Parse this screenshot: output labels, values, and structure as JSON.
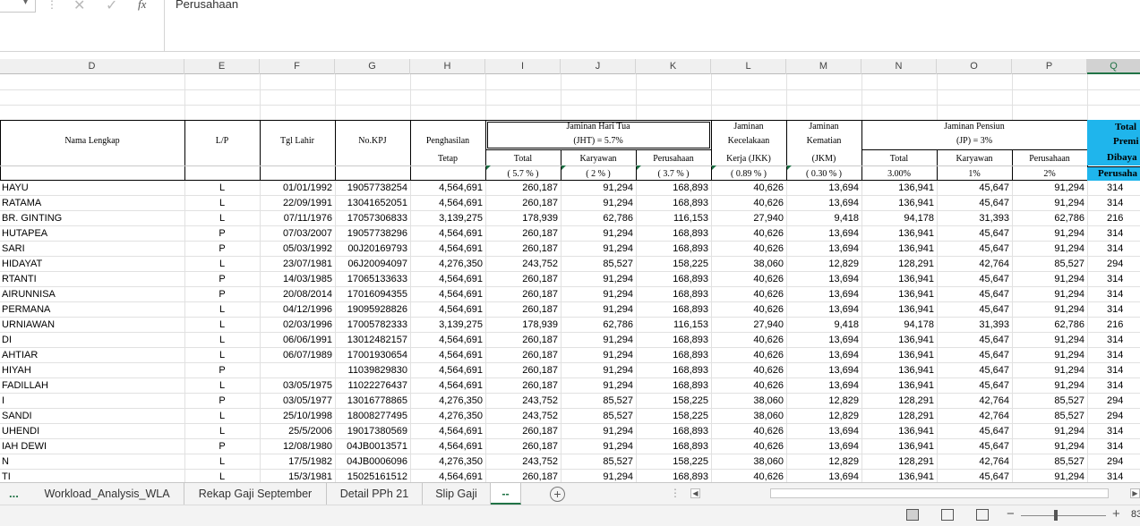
{
  "formula_bar": {
    "cancel_icon": "✕",
    "enter_icon": "✓",
    "fx_label": "fx",
    "content": "Perusahaan"
  },
  "columns": [
    "D",
    "E",
    "F",
    "G",
    "H",
    "I",
    "J",
    "K",
    "L",
    "M",
    "N",
    "O",
    "P",
    "Q"
  ],
  "header": {
    "nama": "Nama Lengkap",
    "lp": "L/P",
    "tgl_lahir": "Tgl Lahir",
    "no_kpj": "No.KPJ",
    "penghasilan_1": "Penghasilan",
    "penghasilan_2": "Tetap",
    "jht_1": "Jaminan Hari Tua",
    "jht_2": "(JHT) = 5.7%",
    "jht_total": "Total",
    "jht_total_pct": "( 5.7 % )",
    "jht_karyawan": "Karyawan",
    "jht_karyawan_pct": "( 2 % )",
    "jht_perusahaan": "Perusahaan",
    "jht_perusahaan_pct": "( 3.7 % )",
    "jkk_1": "Jaminan",
    "jkk_2": "Kecelakaan",
    "jkk_3": "Kerja (JKK)",
    "jkk_pct": "( 0.89 % )",
    "jkm_1": "Jaminan",
    "jkm_2": "Kematian",
    "jkm_3": "(JKM)",
    "jkm_pct": "( 0.30 % )",
    "jp_1": "Jaminan Pensiun",
    "jp_2": "(JP) = 3%",
    "jp_total": "Total",
    "jp_total_pct": "3.00%",
    "jp_karyawan": "Karyawan",
    "jp_karyawan_pct": "1%",
    "jp_perusahaan": "Perusahaan",
    "jp_perusahaan_pct": "2%",
    "q_1": "Total",
    "q_2": "Premi",
    "q_3": "Dibaya",
    "q_4": "Perusaha"
  },
  "rows": [
    [
      "HAYU",
      "L",
      "01/01/1992",
      "19057738254",
      "4,564,691",
      "260,187",
      "91,294",
      "168,893",
      "40,626",
      "13,694",
      "136,941",
      "45,647",
      "91,294",
      "314"
    ],
    [
      "RATAMA",
      "L",
      "22/09/1991",
      "13041652051",
      "4,564,691",
      "260,187",
      "91,294",
      "168,893",
      "40,626",
      "13,694",
      "136,941",
      "45,647",
      "91,294",
      "314"
    ],
    [
      " BR. GINTING",
      "L",
      "07/11/1976",
      "17057306833",
      "3,139,275",
      "178,939",
      "62,786",
      "116,153",
      "27,940",
      "9,418",
      "94,178",
      "31,393",
      "62,786",
      "216"
    ],
    [
      "HUTAPEA",
      "P",
      "07/03/2007",
      "19057738296",
      "4,564,691",
      "260,187",
      "91,294",
      "168,893",
      "40,626",
      "13,694",
      "136,941",
      "45,647",
      "91,294",
      "314"
    ],
    [
      "SARI",
      "P",
      "05/03/1992",
      "00J20169793",
      "4,564,691",
      "260,187",
      "91,294",
      "168,893",
      "40,626",
      "13,694",
      "136,941",
      "45,647",
      "91,294",
      "314"
    ],
    [
      " HIDAYAT",
      "L",
      "23/07/1981",
      "06J20094097",
      "4,276,350",
      "243,752",
      "85,527",
      "158,225",
      "38,060",
      "12,829",
      "128,291",
      "42,764",
      "85,527",
      "294"
    ],
    [
      "RTANTI",
      "P",
      "14/03/1985",
      "17065133633",
      "4,564,691",
      "260,187",
      "91,294",
      "168,893",
      "40,626",
      "13,694",
      "136,941",
      "45,647",
      "91,294",
      "314"
    ],
    [
      "AIRUNNISA",
      "P",
      "20/08/2014",
      "17016094355",
      "4,564,691",
      "260,187",
      "91,294",
      "168,893",
      "40,626",
      "13,694",
      "136,941",
      "45,647",
      "91,294",
      "314"
    ],
    [
      "PERMANA",
      "L",
      "04/12/1996",
      "19095928826",
      "4,564,691",
      "260,187",
      "91,294",
      "168,893",
      "40,626",
      "13,694",
      "136,941",
      "45,647",
      "91,294",
      "314"
    ],
    [
      "URNIAWAN",
      "L",
      "02/03/1996",
      "17005782333",
      "3,139,275",
      "178,939",
      "62,786",
      "116,153",
      "27,940",
      "9,418",
      "94,178",
      "31,393",
      "62,786",
      "216"
    ],
    [
      "DI",
      "L",
      "06/06/1991",
      "13012482157",
      "4,564,691",
      "260,187",
      "91,294",
      "168,893",
      "40,626",
      "13,694",
      "136,941",
      "45,647",
      "91,294",
      "314"
    ],
    [
      "AHTIAR",
      "L",
      "06/07/1989",
      "17001930654",
      "4,564,691",
      "260,187",
      "91,294",
      "168,893",
      "40,626",
      "13,694",
      "136,941",
      "45,647",
      "91,294",
      "314"
    ],
    [
      "HIYAH",
      "P",
      "",
      "11039829830",
      "4,564,691",
      "260,187",
      "91,294",
      "168,893",
      "40,626",
      "13,694",
      "136,941",
      "45,647",
      "91,294",
      "314"
    ],
    [
      " FADILLAH",
      "L",
      "03/05/1975",
      "11022276437",
      "4,564,691",
      "260,187",
      "91,294",
      "168,893",
      "40,626",
      "13,694",
      "136,941",
      "45,647",
      "91,294",
      "314"
    ],
    [
      "I",
      "P",
      "03/05/1977",
      "13016778865",
      "4,276,350",
      "243,752",
      "85,527",
      "158,225",
      "38,060",
      "12,829",
      "128,291",
      "42,764",
      "85,527",
      "294"
    ],
    [
      "SANDI",
      "L",
      "25/10/1998",
      "18008277495",
      "4,276,350",
      "243,752",
      "85,527",
      "158,225",
      "38,060",
      "12,829",
      "128,291",
      "42,764",
      "85,527",
      "294"
    ],
    [
      "UHENDI",
      "L",
      "25/5/2006",
      "19017380569",
      "4,564,691",
      "260,187",
      "91,294",
      "168,893",
      "40,626",
      "13,694",
      "136,941",
      "45,647",
      "91,294",
      "314"
    ],
    [
      "IAH DEWI",
      "P",
      "12/08/1980",
      "04JB0013571",
      "4,564,691",
      "260,187",
      "91,294",
      "168,893",
      "40,626",
      "13,694",
      "136,941",
      "45,647",
      "91,294",
      "314"
    ],
    [
      "N",
      "L",
      "17/5/1982",
      "04JB0006096",
      "4,276,350",
      "243,752",
      "85,527",
      "158,225",
      "38,060",
      "12,829",
      "128,291",
      "42,764",
      "85,527",
      "294"
    ],
    [
      "TI",
      "L",
      "15/3/1981",
      "15025161512",
      "4,564,691",
      "260,187",
      "91,294",
      "168,893",
      "40,626",
      "13,694",
      "136,941",
      "45,647",
      "91,294",
      "314"
    ]
  ],
  "tabs": {
    "more": "...",
    "items": [
      "Workload_Analysis_WLA",
      "Rekap Gaji September",
      "Detail PPh 21",
      "Slip Gaji",
      "--"
    ],
    "active_index": 4,
    "add_sheet": "+"
  },
  "status": {
    "zoom_minus": "−",
    "zoom_plus": "+",
    "zoom_pct": "83"
  },
  "icons": {
    "name_box_dropdown": "chevron-down-icon",
    "cancel": "close-icon",
    "enter": "check-icon",
    "function": "fx-icon",
    "add_sheet": "plus-circle-icon",
    "view_normal": "grid-icon",
    "view_page_layout": "page-layout-icon",
    "view_page_break": "page-break-icon"
  },
  "colors": {
    "accent": "#217346",
    "header_blue": "#1fb5ec"
  }
}
